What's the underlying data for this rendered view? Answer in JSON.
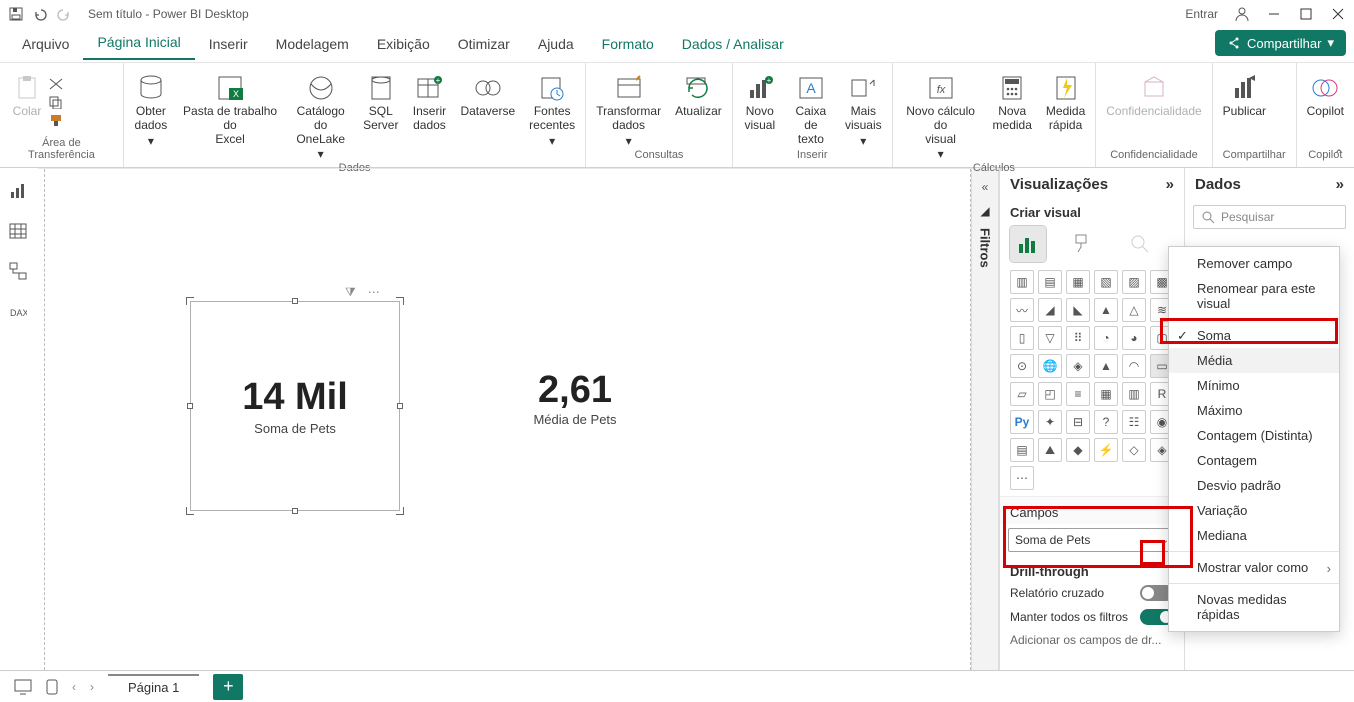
{
  "title": "Sem título - Power BI Desktop",
  "signin": "Entrar",
  "menu": {
    "arquivo": "Arquivo",
    "inicio": "Página Inicial",
    "inserir": "Inserir",
    "modelagem": "Modelagem",
    "exibicao": "Exibição",
    "otimizar": "Otimizar",
    "ajuda": "Ajuda",
    "formato": "Formato",
    "dados": "Dados / Analisar",
    "share": "Compartilhar"
  },
  "ribbon": {
    "clip": {
      "colar": "Colar",
      "label": "Área de Transferência"
    },
    "dados": {
      "obter": "Obter\ndados",
      "excel": "Pasta de trabalho do\nExcel",
      "onelake": "Catálogo\ndo OneLake",
      "sql": "SQL\nServer",
      "inserir": "Inserir\ndados",
      "dataverse": "Dataverse",
      "fontes": "Fontes\nrecentes",
      "label": "Dados"
    },
    "consultas": {
      "transformar": "Transformar\ndados",
      "atualizar": "Atualizar",
      "label": "Consultas"
    },
    "inserir": {
      "novo": "Novo\nvisual",
      "caixa": "Caixa de\ntexto",
      "mais": "Mais\nvisuais",
      "label": "Inserir"
    },
    "calc": {
      "novoc": "Novo cálculo do\nvisual",
      "novam": "Nova\nmedida",
      "rapida": "Medida\nrápida",
      "label": "Cálculos"
    },
    "conf": {
      "btn": "Confidencialidade",
      "label": "Confidencialidade"
    },
    "compart": {
      "btn": "Publicar",
      "label": "Compartilhar"
    },
    "copilot": {
      "btn": "Copilot",
      "label": "Copilot"
    }
  },
  "filters": "Filtros",
  "visualizations": {
    "title": "Visualizações",
    "criar": "Criar visual",
    "campos": "Campos",
    "well": "Soma de Pets",
    "drill": "Drill-through",
    "cross": "Relatório cruzado",
    "keep": "Manter todos os filtros",
    "adddrill": "Adicionar os campos de dr..."
  },
  "dados_pane": {
    "title": "Dados",
    "search": "Pesquisar"
  },
  "canvas": {
    "v1num": "14 Mil",
    "v1cap": "Soma de Pets",
    "v2num": "2,61",
    "v2cap": "Média de Pets"
  },
  "ctx": {
    "remove": "Remover campo",
    "rename": "Renomear para este visual",
    "soma": "Soma",
    "media": "Média",
    "min": "Mínimo",
    "max": "Máximo",
    "cdist": "Contagem (Distinta)",
    "cont": "Contagem",
    "desvio": "Desvio padrão",
    "variacao": "Variação",
    "mediana": "Mediana",
    "mostrar": "Mostrar valor como",
    "novas": "Novas medidas rápidas"
  },
  "page": "Página 1"
}
